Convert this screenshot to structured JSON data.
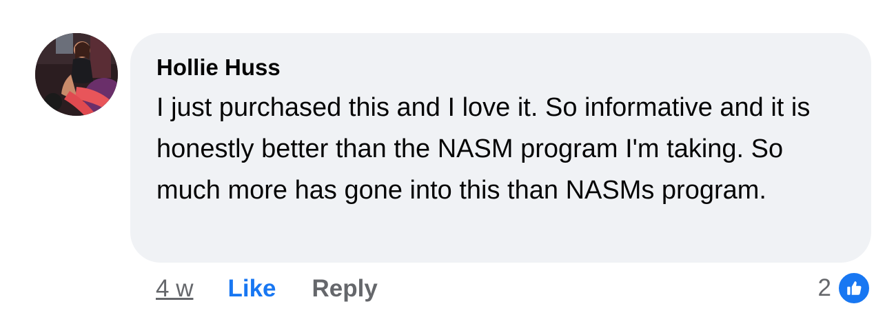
{
  "comment": {
    "author": "Hollie Huss",
    "text": "I just purchased this and I love it. So informative and it is honestly better than the NASM program I'm taking. So much more has gone into this than NASMs program."
  },
  "actions": {
    "time_label": "4 w",
    "like_label": "Like",
    "reply_label": "Reply"
  },
  "reactions": {
    "count": "2",
    "type_icon": "thumbs-up-icon"
  },
  "colors": {
    "bubble_bg": "#f0f2f5",
    "accent": "#1877f2",
    "muted_text": "#65676b",
    "primary_text": "#050505"
  }
}
